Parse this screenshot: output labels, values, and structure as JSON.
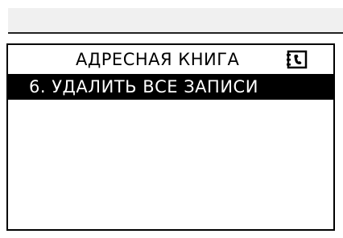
{
  "screen": {
    "title": "АДРЕСНАЯ КНИГА",
    "title_icon": "address-book-icon",
    "menu": {
      "items": [
        {
          "label": "6. УДАЛИТЬ ВСЕ ЗАПИСИ",
          "selected": true
        }
      ]
    }
  },
  "colors": {
    "background": "#ffffff",
    "highlight": "#000000",
    "highlight_text": "#ffffff",
    "top_strip": "#f0f0f0"
  }
}
